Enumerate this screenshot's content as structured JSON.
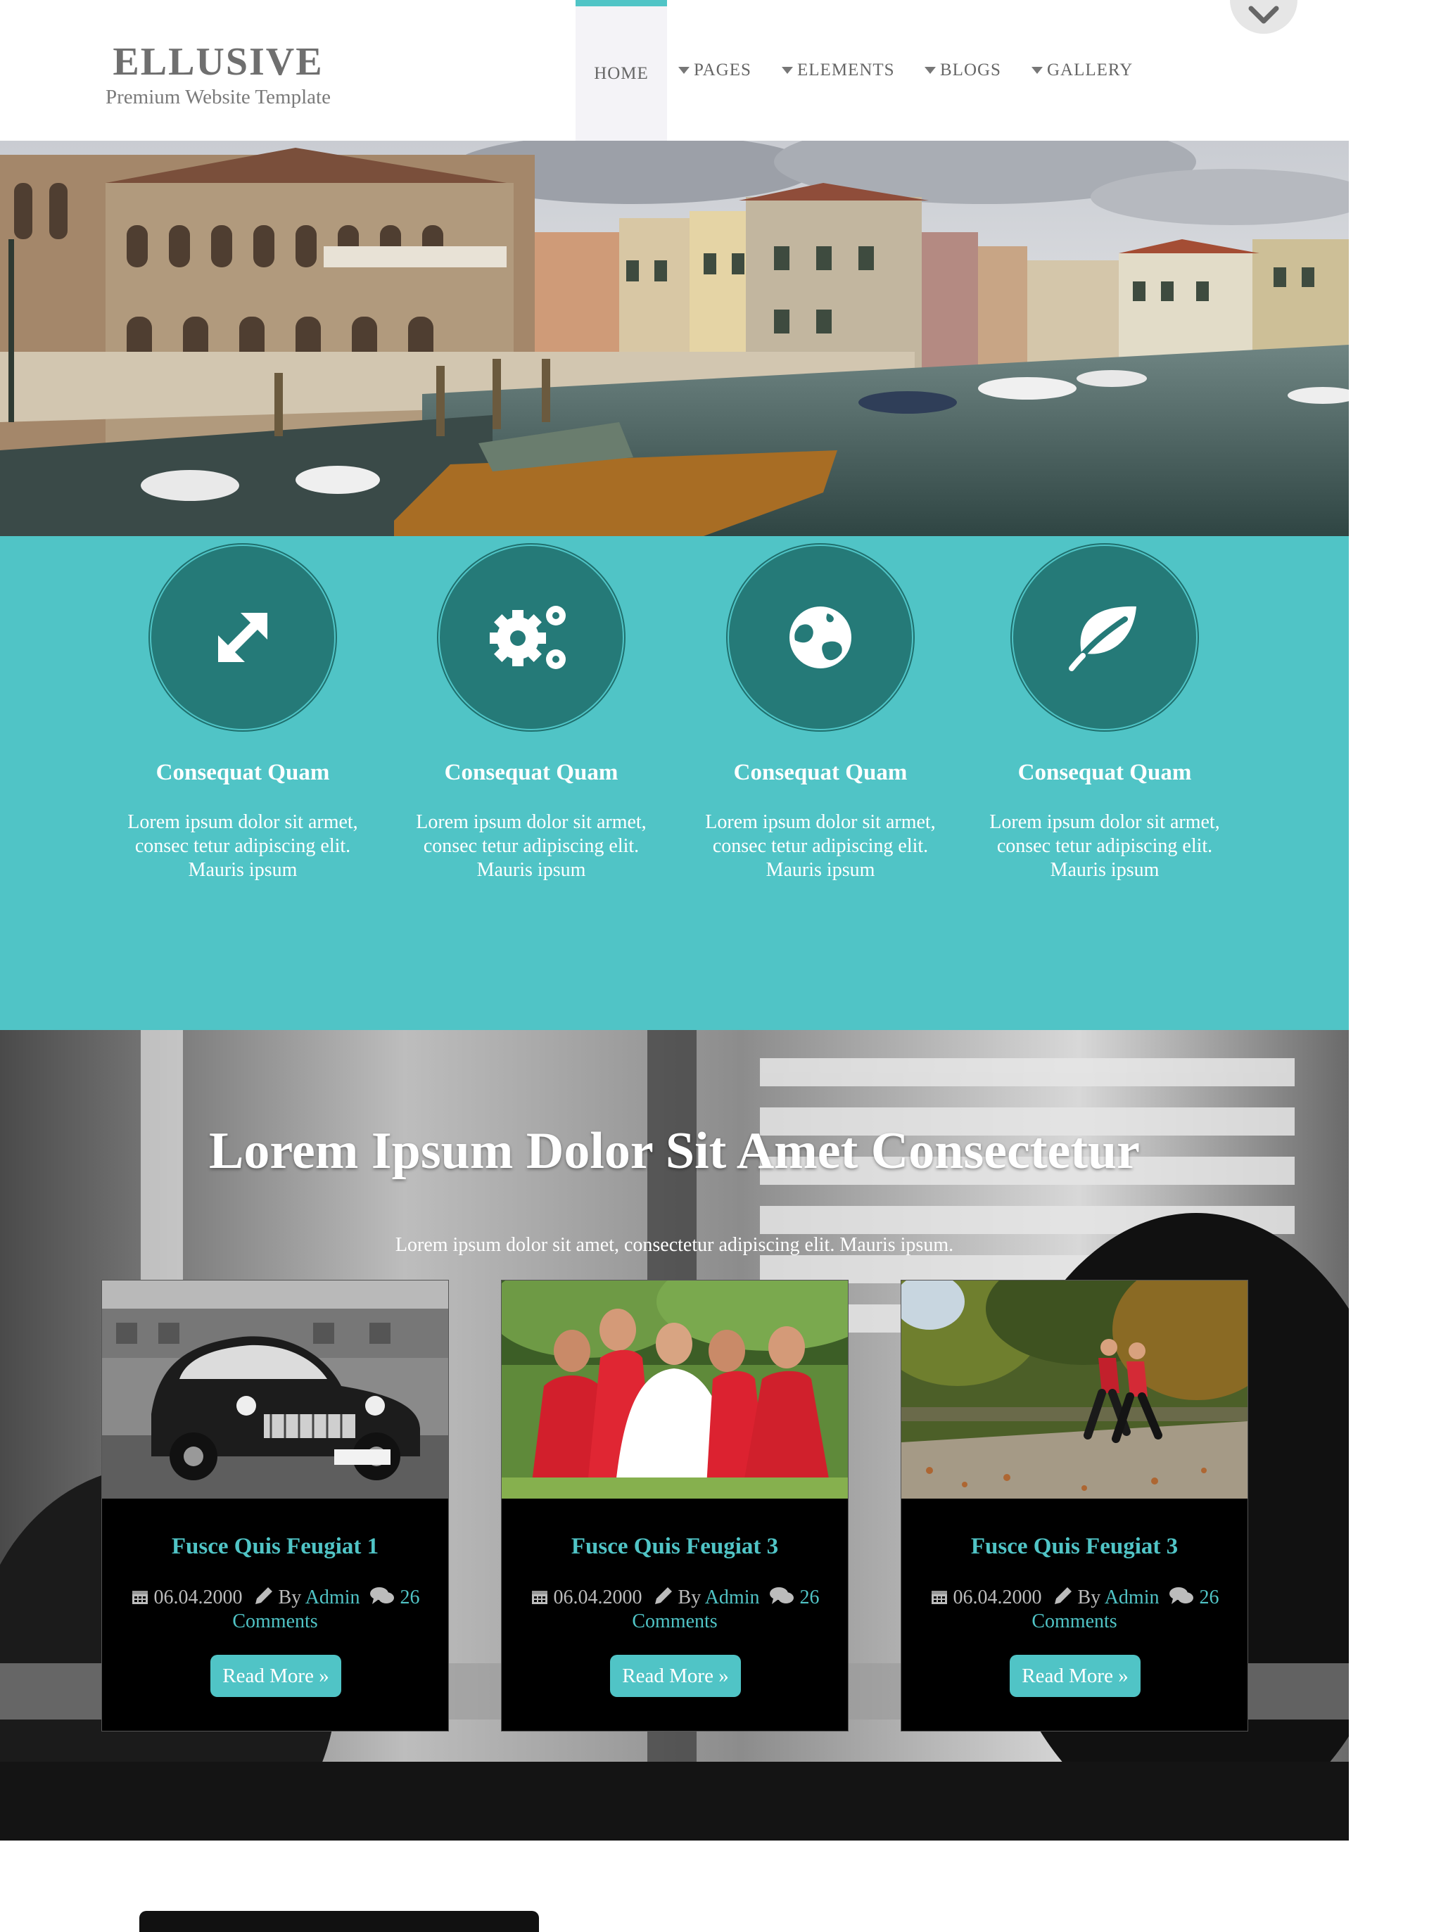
{
  "header": {
    "logo_title": "ELLUSIVE",
    "logo_tagline": "Premium Website Template",
    "nav": {
      "home": "HOME",
      "pages": "PAGES",
      "elements": "ELEMENTS",
      "blogs": "BLOGS",
      "gallery": "GALLERY"
    }
  },
  "features": [
    {
      "icon": "resize-arrows-icon",
      "title": "Consequat Quam",
      "text": "Lorem ipsum dolor sit armet, consec tetur adipiscing elit. Mauris ipsum"
    },
    {
      "icon": "gears-icon",
      "title": "Consequat Quam",
      "text": "Lorem ipsum dolor sit armet, consec tetur adipiscing elit. Mauris ipsum"
    },
    {
      "icon": "globe-icon",
      "title": "Consequat Quam",
      "text": "Lorem ipsum dolor sit armet, consec tetur adipiscing elit. Mauris ipsum"
    },
    {
      "icon": "leaf-icon",
      "title": "Consequat Quam",
      "text": "Lorem ipsum dolor sit armet, consec tetur adipiscing elit. Mauris ipsum"
    }
  ],
  "posts": {
    "heading": "Lorem Ipsum Dolor Sit Amet Consectetur",
    "subheading": "Lorem ipsum dolor sit amet, consectetur adipiscing elit. Mauris ipsum.",
    "cards": [
      {
        "title": "Fusce Quis Feugiat 1",
        "date": "06.04.2000",
        "by": "By",
        "author": "Admin",
        "comments_count": "26",
        "comments_label": "Comments",
        "button": "Read More »"
      },
      {
        "title": "Fusce Quis Feugiat 3",
        "date": "06.04.2000",
        "by": "By",
        "author": "Admin",
        "comments_count": "26",
        "comments_label": "Comments",
        "button": "Read More »"
      },
      {
        "title": "Fusce Quis Feugiat 3",
        "date": "06.04.2000",
        "by": "By",
        "author": "Admin",
        "comments_count": "26",
        "comments_label": "Comments",
        "button": "Read More »"
      }
    ]
  },
  "colors": {
    "accent": "#50c4c6",
    "icon_circle": "#257a78",
    "card_bg": "#000000"
  }
}
